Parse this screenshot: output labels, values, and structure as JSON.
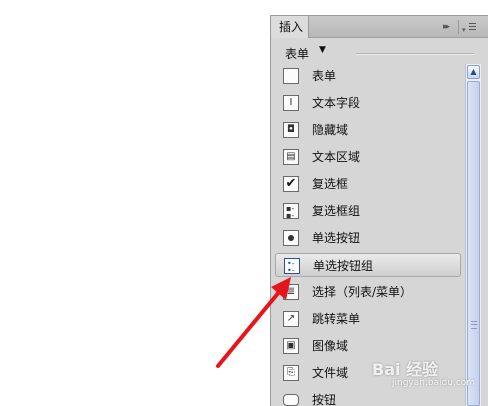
{
  "panel": {
    "tab_label": "插入",
    "collapse_glyph": "▸▸",
    "menu_glyph": "▾",
    "category": "表单",
    "category_arrow": "▼"
  },
  "items": [
    {
      "label": "表单",
      "icon": "form-icon",
      "glyph": ""
    },
    {
      "label": "文本字段",
      "icon": "text-field-icon",
      "glyph": "I"
    },
    {
      "label": "隐藏域",
      "icon": "hidden-field-icon",
      "glyph": "◘"
    },
    {
      "label": "文本区域",
      "icon": "text-area-icon",
      "glyph": "▤"
    },
    {
      "label": "复选框",
      "icon": "checkbox-icon",
      "glyph": "✔"
    },
    {
      "label": "复选框组",
      "icon": "checkbox-group-icon",
      "glyph": "▪-\n▪-\n▪-"
    },
    {
      "label": "单选按钮",
      "icon": "radio-button-icon",
      "glyph": ""
    },
    {
      "label": "单选按钮组",
      "icon": "radio-group-icon",
      "glyph": "•-\n•-\n•-"
    },
    {
      "label": "选择（列表/菜单）",
      "icon": "select-list-icon",
      "glyph": "≣"
    },
    {
      "label": "跳转菜单",
      "icon": "jump-menu-icon",
      "glyph": "↗"
    },
    {
      "label": "图像域",
      "icon": "image-field-icon",
      "glyph": "▣"
    },
    {
      "label": "文件域",
      "icon": "file-field-icon",
      "glyph": "⎘"
    },
    {
      "label": "按钮",
      "icon": "button-icon",
      "glyph": ""
    }
  ],
  "active_index": 7,
  "scroll": {
    "up_glyph": "▲"
  },
  "watermark": {
    "main": "Bai 经验",
    "sub": "jingyan.baidu.com"
  },
  "colors": {
    "arrow": "#e8141b",
    "panel": "#d6d6d6",
    "scrollbar": "#e9eef8"
  }
}
